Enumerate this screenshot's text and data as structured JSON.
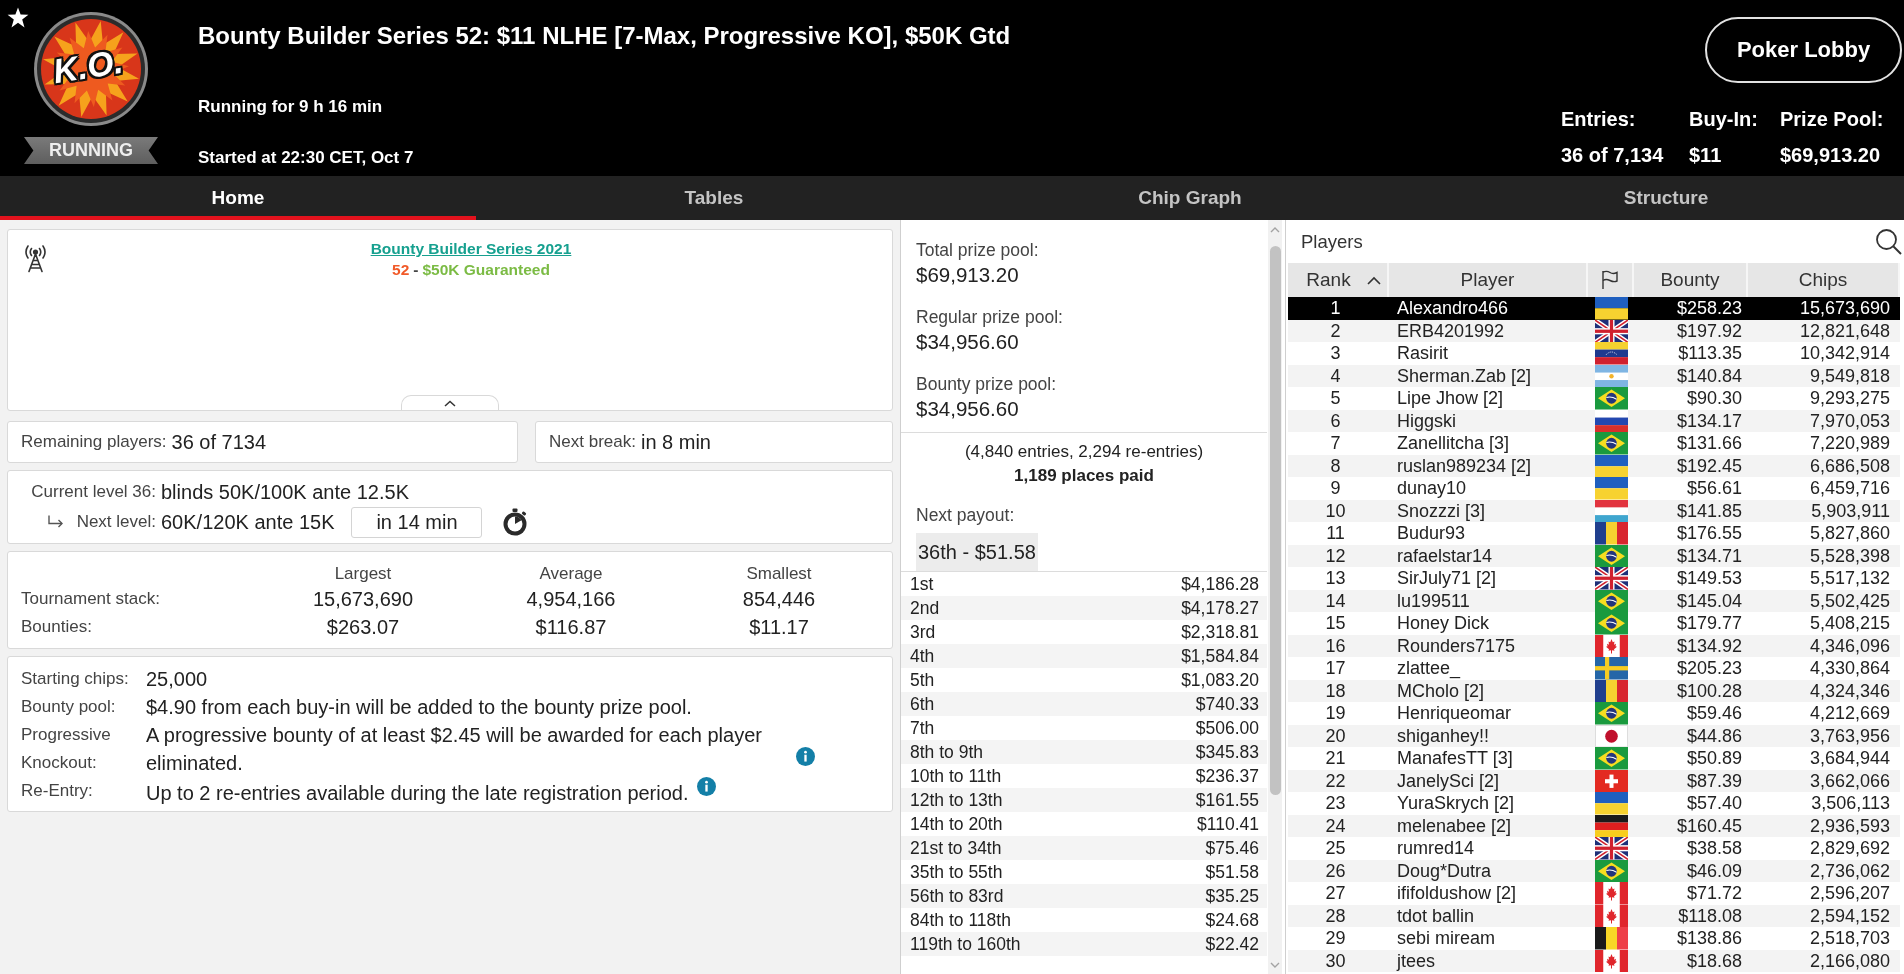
{
  "header": {
    "logo_text": "K.O.",
    "status": "RUNNING",
    "title": "Bounty Builder Series 52: $11 NLHE [7-Max, Progressive KO], $50K Gtd",
    "running_for": "Running for 9 h 16 min",
    "started_at": "Started at 22:30 CET, Oct 7",
    "lobby_button": "Poker Lobby",
    "stats": [
      {
        "label": "Entries:",
        "value": "36 of 7,134"
      },
      {
        "label": "Buy-In:",
        "value": "$11"
      },
      {
        "label": "Prize Pool:",
        "value": "$69,913.20"
      }
    ]
  },
  "tabs": [
    {
      "label": "Home",
      "selected": true
    },
    {
      "label": "Tables",
      "selected": false
    },
    {
      "label": "Chip Graph",
      "selected": false
    },
    {
      "label": "Structure",
      "selected": false
    }
  ],
  "series": {
    "link": "Bounty Builder Series 2021",
    "subtitle": [
      {
        "kind": "number",
        "text": "52"
      },
      {
        "kind": "separator",
        "text": "-"
      },
      {
        "kind": "guarantee",
        "text": "$50K Guaranteed"
      }
    ]
  },
  "summary": [
    {
      "label": "Remaining players:",
      "value": "36 of 7134"
    },
    {
      "label": "Next break:",
      "value": "in 8 min"
    }
  ],
  "levels": {
    "current": {
      "label": "Current level 36:",
      "value": "blinds 50K/100K ante 12.5K"
    },
    "next": {
      "label": "Next level:",
      "value": "60K/120K ante 15K",
      "countdown": "in 14 min"
    }
  },
  "stacks": {
    "columns": [
      "Largest",
      "Average",
      "Smallest"
    ],
    "rows": [
      {
        "label": "Tournament stack:",
        "values": [
          "15,673,690",
          "4,954,166",
          "854,446"
        ]
      },
      {
        "label": "Bounties:",
        "values": [
          "$263.07",
          "$116.87",
          "$11.17"
        ]
      }
    ]
  },
  "details": [
    {
      "label": "Starting chips:",
      "value": "25,000",
      "info": false
    },
    {
      "label": "Bounty pool:",
      "value": "$4.90 from each buy-in will be added to the bounty prize pool.",
      "info": false
    },
    {
      "label": "Progressive Knockout:",
      "value": "A progressive bounty of at least $2.45 will be awarded for each player eliminated.",
      "info": true
    },
    {
      "label": "Re-Entry:",
      "value": "Up to 2 re-entries available during the late registration period.",
      "info": true
    }
  ],
  "prize_pool": {
    "pools": [
      {
        "label": "Total prize pool:",
        "value": "$69,913.20"
      },
      {
        "label": "Regular prize pool:",
        "value": "$34,956.60"
      },
      {
        "label": "Bounty prize pool:",
        "value": "$34,956.60"
      }
    ],
    "entries_note": "(4,840 entries, 2,294 re-entries)",
    "places_paid": "1,189 places paid",
    "next_payout_label": "Next payout:",
    "next_payout": "36th - $51.58",
    "payouts": [
      {
        "place": "1st",
        "amount": "$4,186.28"
      },
      {
        "place": "2nd",
        "amount": "$4,178.27"
      },
      {
        "place": "3rd",
        "amount": "$2,318.81"
      },
      {
        "place": "4th",
        "amount": "$1,584.84"
      },
      {
        "place": "5th",
        "amount": "$1,083.20"
      },
      {
        "place": "6th",
        "amount": "$740.33"
      },
      {
        "place": "7th",
        "amount": "$506.00"
      },
      {
        "place": "8th to 9th",
        "amount": "$345.83"
      },
      {
        "place": "10th to 11th",
        "amount": "$236.37"
      },
      {
        "place": "12th to 13th",
        "amount": "$161.55"
      },
      {
        "place": "14th to 20th",
        "amount": "$110.41"
      },
      {
        "place": "21st to 34th",
        "amount": "$75.46"
      },
      {
        "place": "35th to 55th",
        "amount": "$51.58"
      },
      {
        "place": "56th to 83rd",
        "amount": "$35.25"
      },
      {
        "place": "84th to 118th",
        "amount": "$24.68"
      },
      {
        "place": "119th to 160th",
        "amount": "$22.42"
      }
    ]
  },
  "players": {
    "title": "Players",
    "columns": [
      {
        "kind": "text",
        "label": "Rank",
        "sorted": true
      },
      {
        "kind": "text",
        "label": "Player",
        "sorted": false
      },
      {
        "kind": "flag",
        "sorted": false
      },
      {
        "kind": "text",
        "label": "Bounty",
        "sorted": false
      },
      {
        "kind": "text",
        "label": "Chips",
        "sorted": false
      }
    ],
    "rows": [
      {
        "rank": "1",
        "player": "Alexandro466",
        "flag": {
          "kind": "ukraine"
        },
        "bounty": "$258.23",
        "chips": "15,673,690",
        "selected": true
      },
      {
        "rank": "2",
        "player": "ERB4201992",
        "flag": {
          "kind": "uk"
        },
        "bounty": "$197.92",
        "chips": "12,821,648",
        "selected": false
      },
      {
        "rank": "3",
        "player": "Rasirit",
        "flag": {
          "kind": "venezuela"
        },
        "bounty": "$113.35",
        "chips": "10,342,914",
        "selected": false
      },
      {
        "rank": "4",
        "player": "Sherman.Zab [2]",
        "flag": {
          "kind": "argentina"
        },
        "bounty": "$140.84",
        "chips": "9,549,818",
        "selected": false
      },
      {
        "rank": "5",
        "player": "Lipe Jhow [2]",
        "flag": {
          "kind": "brazil"
        },
        "bounty": "$90.30",
        "chips": "9,293,275",
        "selected": false
      },
      {
        "rank": "6",
        "player": "Higgski",
        "flag": {
          "kind": "russia"
        },
        "bounty": "$134.17",
        "chips": "7,970,053",
        "selected": false
      },
      {
        "rank": "7",
        "player": "Zanellitcha [3]",
        "flag": {
          "kind": "brazil"
        },
        "bounty": "$131.66",
        "chips": "7,220,989",
        "selected": false
      },
      {
        "rank": "8",
        "player": "ruslan989234 [2]",
        "flag": {
          "kind": "ukraine"
        },
        "bounty": "$192.45",
        "chips": "6,686,508",
        "selected": false
      },
      {
        "rank": "9",
        "player": "dunay10",
        "flag": {
          "kind": "ukraine"
        },
        "bounty": "$56.61",
        "chips": "6,459,716",
        "selected": false
      },
      {
        "rank": "10",
        "player": "Snozzzi [3]",
        "flag": {
          "kind": "luxembourg"
        },
        "bounty": "$141.85",
        "chips": "5,903,911",
        "selected": false
      },
      {
        "rank": "11",
        "player": "Budur93",
        "flag": {
          "kind": "romania"
        },
        "bounty": "$176.55",
        "chips": "5,827,860",
        "selected": false
      },
      {
        "rank": "12",
        "player": "rafaelstar14",
        "flag": {
          "kind": "brazil"
        },
        "bounty": "$134.71",
        "chips": "5,528,398",
        "selected": false
      },
      {
        "rank": "13",
        "player": "SirJuly71 [2]",
        "flag": {
          "kind": "uk"
        },
        "bounty": "$149.53",
        "chips": "5,517,132",
        "selected": false
      },
      {
        "rank": "14",
        "player": "lu199511",
        "flag": {
          "kind": "brazil"
        },
        "bounty": "$145.04",
        "chips": "5,502,425",
        "selected": false
      },
      {
        "rank": "15",
        "player": "Honey Dick",
        "flag": {
          "kind": "brazil"
        },
        "bounty": "$179.77",
        "chips": "5,408,215",
        "selected": false
      },
      {
        "rank": "16",
        "player": "Rounders7175",
        "flag": {
          "kind": "canada"
        },
        "bounty": "$134.92",
        "chips": "4,346,096",
        "selected": false
      },
      {
        "rank": "17",
        "player": "zlattee_",
        "flag": {
          "kind": "sweden"
        },
        "bounty": "$205.23",
        "chips": "4,330,864",
        "selected": false
      },
      {
        "rank": "18",
        "player": "MCholo [2]",
        "flag": {
          "kind": "romania"
        },
        "bounty": "$100.28",
        "chips": "4,324,346",
        "selected": false
      },
      {
        "rank": "19",
        "player": "Henriqueomar",
        "flag": {
          "kind": "brazil"
        },
        "bounty": "$59.46",
        "chips": "4,212,669",
        "selected": false
      },
      {
        "rank": "20",
        "player": "shiganhey!!",
        "flag": {
          "kind": "japan"
        },
        "bounty": "$44.86",
        "chips": "3,763,956",
        "selected": false
      },
      {
        "rank": "21",
        "player": "ManafesTT [3]",
        "flag": {
          "kind": "brazil"
        },
        "bounty": "$50.89",
        "chips": "3,684,944",
        "selected": false
      },
      {
        "rank": "22",
        "player": "JanelySci [2]",
        "flag": {
          "kind": "switzerland"
        },
        "bounty": "$87.39",
        "chips": "3,662,066",
        "selected": false
      },
      {
        "rank": "23",
        "player": "YuraSkrych [2]",
        "flag": {
          "kind": "ukraine"
        },
        "bounty": "$57.40",
        "chips": "3,506,113",
        "selected": false
      },
      {
        "rank": "24",
        "player": "melenabee [2]",
        "flag": {
          "kind": "germany"
        },
        "bounty": "$160.45",
        "chips": "2,936,593",
        "selected": false
      },
      {
        "rank": "25",
        "player": "rumred14",
        "flag": {
          "kind": "uk"
        },
        "bounty": "$38.58",
        "chips": "2,829,692",
        "selected": false
      },
      {
        "rank": "26",
        "player": "Doug*Dutra",
        "flag": {
          "kind": "brazil"
        },
        "bounty": "$46.09",
        "chips": "2,736,062",
        "selected": false
      },
      {
        "rank": "27",
        "player": "ififoldushow [2]",
        "flag": {
          "kind": "canada"
        },
        "bounty": "$71.72",
        "chips": "2,596,207",
        "selected": false
      },
      {
        "rank": "28",
        "player": "tdot ballin",
        "flag": {
          "kind": "canada"
        },
        "bounty": "$118.08",
        "chips": "2,594,152",
        "selected": false
      },
      {
        "rank": "29",
        "player": "sebi miream",
        "flag": {
          "kind": "belgium"
        },
        "bounty": "$138.86",
        "chips": "2,518,703",
        "selected": false
      },
      {
        "rank": "30",
        "player": "jtees",
        "flag": {
          "kind": "canada"
        },
        "bounty": "$18.68",
        "chips": "2,166,080",
        "selected": false
      }
    ]
  }
}
